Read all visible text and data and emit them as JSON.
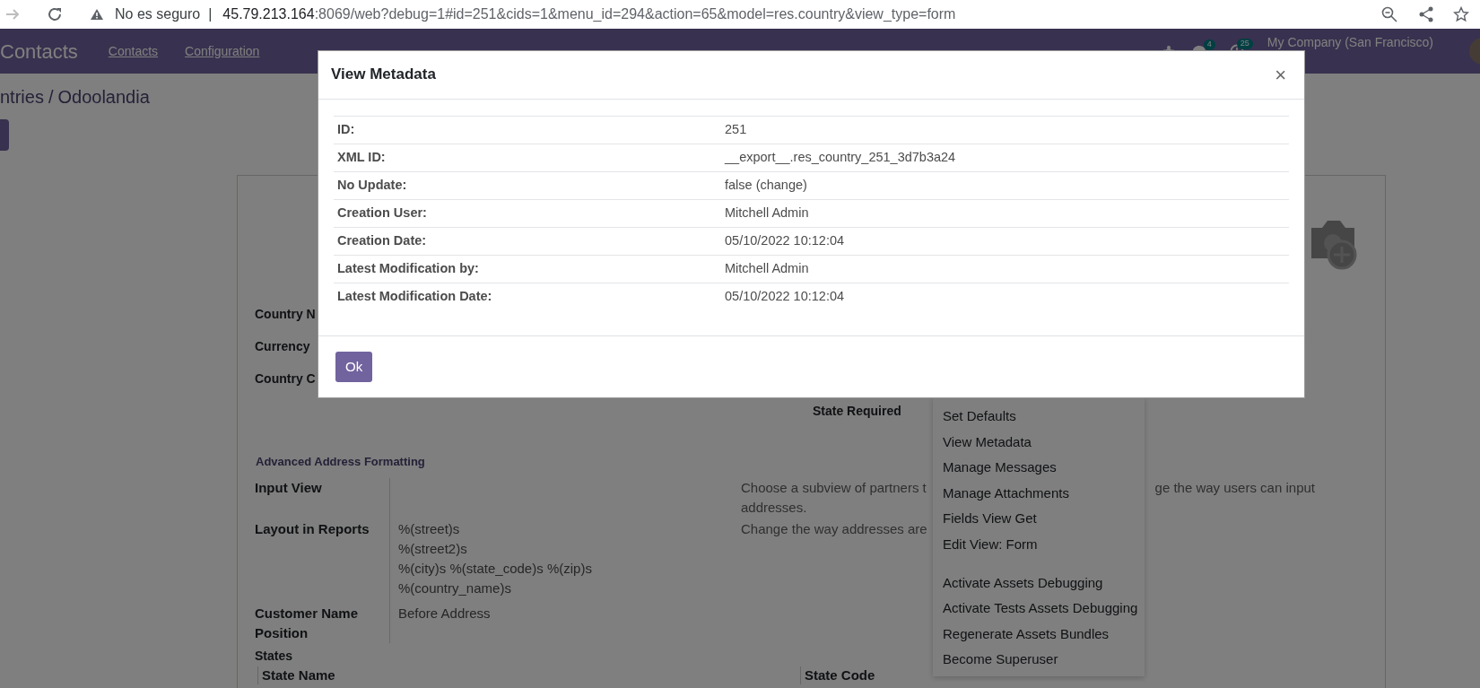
{
  "browser": {
    "security_label": "No es seguro",
    "separator": "|",
    "url_host": "45.79.213.164",
    "url_rest": ":8069/web?debug=1#id=251&cids=1&menu_id=294&action=65&model=res.country&view_type=form"
  },
  "navbar": {
    "app_name": "Contacts",
    "menus": [
      "Contacts",
      "Configuration"
    ],
    "messages_count": "4",
    "activities_count": "25",
    "company": "My Company (San Francisco)"
  },
  "breadcrumb": {
    "parent": "ntries",
    "separator": "/",
    "current": "Odoolandia"
  },
  "form": {
    "fields": [
      "Country N",
      "Currency",
      "Country C"
    ],
    "state_required_label": "State Required",
    "section_title": "Advanced Address Formatting",
    "address_rows": [
      {
        "label": "Input View",
        "help": [
          "Choose a subview of partners t",
          "ge the way users can input",
          "addresses."
        ]
      },
      {
        "label": "Layout in Reports",
        "value_lines": [
          "%(street)s",
          "%(street2)s",
          "%(city)s %(state_code)s %(zip)s",
          "%(country_name)s"
        ],
        "help": [
          "Change the way addresses are"
        ]
      },
      {
        "label": "Customer Name Position",
        "value_lines": [
          "Before Address"
        ]
      }
    ],
    "states_title": "States",
    "states_columns": [
      "State Name",
      "State Code"
    ]
  },
  "debug_menu": {
    "groups": [
      [
        "Set Defaults",
        "View Metadata",
        "Manage Messages",
        "Manage Attachments",
        "Fields View Get",
        "Edit View: Form"
      ],
      [
        "Activate Assets Debugging",
        "Activate Tests Assets Debugging",
        "Regenerate Assets Bundles",
        "Become Superuser"
      ]
    ]
  },
  "modal": {
    "title": "View Metadata",
    "close": "×",
    "rows": [
      {
        "label": "ID:",
        "value": "251"
      },
      {
        "label": "XML ID:",
        "value": "__export__.res_country_251_3d7b3a24"
      },
      {
        "label": "No Update:",
        "value": "false (change)"
      },
      {
        "label": "Creation User:",
        "value": "Mitchell Admin"
      },
      {
        "label": "Creation Date:",
        "value": "05/10/2022 10:12:04"
      },
      {
        "label": "Latest Modification by:",
        "value": "Mitchell Admin"
      },
      {
        "label": "Latest Modification Date:",
        "value": "05/10/2022 10:12:04"
      }
    ],
    "ok_button": "Ok"
  }
}
